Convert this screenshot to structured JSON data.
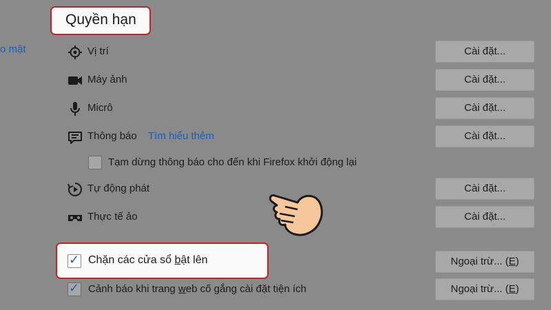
{
  "sidebar": {
    "partial_link": "o mật"
  },
  "section": {
    "title": "Quyền hạn"
  },
  "permissions": [
    {
      "label": "Vị trí",
      "button": "Cài đặt..."
    },
    {
      "label": "Máy ảnh",
      "button": "Cài đặt..."
    },
    {
      "label": "Micrô",
      "button": "Cài đặt..."
    },
    {
      "label": "Thông báo",
      "link": "Tìm hiểu thêm",
      "button": "Cài đặt..."
    },
    {
      "label": "Tự động phát",
      "button": "Cài đặt..."
    },
    {
      "label": "Thực tế ảo",
      "button": "Cài đặt..."
    }
  ],
  "pause_notifications": {
    "label": "Tạm dừng thông báo cho đến khi Firefox khởi động lại",
    "checked": false
  },
  "block_popups": {
    "label_pre": "Chặn các cửa sổ ",
    "label_u": "b",
    "label_post": "ật lên",
    "checked": true,
    "button_pre": "Ngoại trừ... (",
    "button_u": "E",
    "button_post": ")"
  },
  "warn_addons": {
    "label_pre": "Cảnh báo khi trang ",
    "label_u": "w",
    "label_post": "eb cố gắng cài đặt tiện ích",
    "checked": true,
    "button_pre": "Ngoại trừ... (",
    "button_u": "E",
    "button_post": ")"
  },
  "icons": [
    "location-icon",
    "camera-icon",
    "microphone-icon",
    "notification-icon",
    "autoplay-icon",
    "vr-headset-icon",
    "pointing-hand-icon"
  ]
}
